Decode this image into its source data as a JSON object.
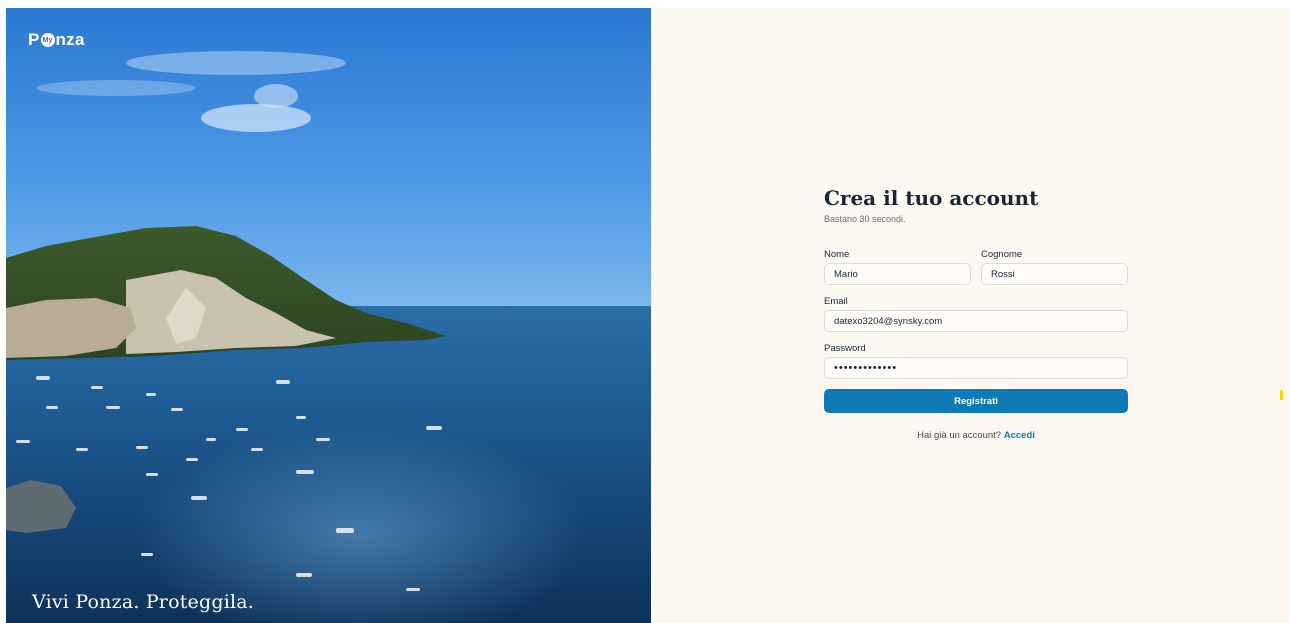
{
  "brand": {
    "logo_prefix": "P",
    "logo_badge": "My",
    "logo_suffix": "nza",
    "tagline": "Vivi Ponza. Proteggila."
  },
  "form": {
    "title": "Crea il tuo account",
    "subtitle": "Bastano 30 secondi.",
    "first_name": {
      "label": "Nome",
      "value": "Mario"
    },
    "last_name": {
      "label": "Cognome",
      "value": "Rossi"
    },
    "email": {
      "label": "Email",
      "value": "datexo3204@synsky.com"
    },
    "password": {
      "label": "Password",
      "value": "•••••••••••••"
    },
    "submit_label": "Registrati",
    "login_prompt": "Hai già un account?",
    "login_link": "Accedi"
  },
  "colors": {
    "accent": "#0f79b6",
    "panel_background": "#fcf8f2",
    "heading": "#1d2733"
  }
}
